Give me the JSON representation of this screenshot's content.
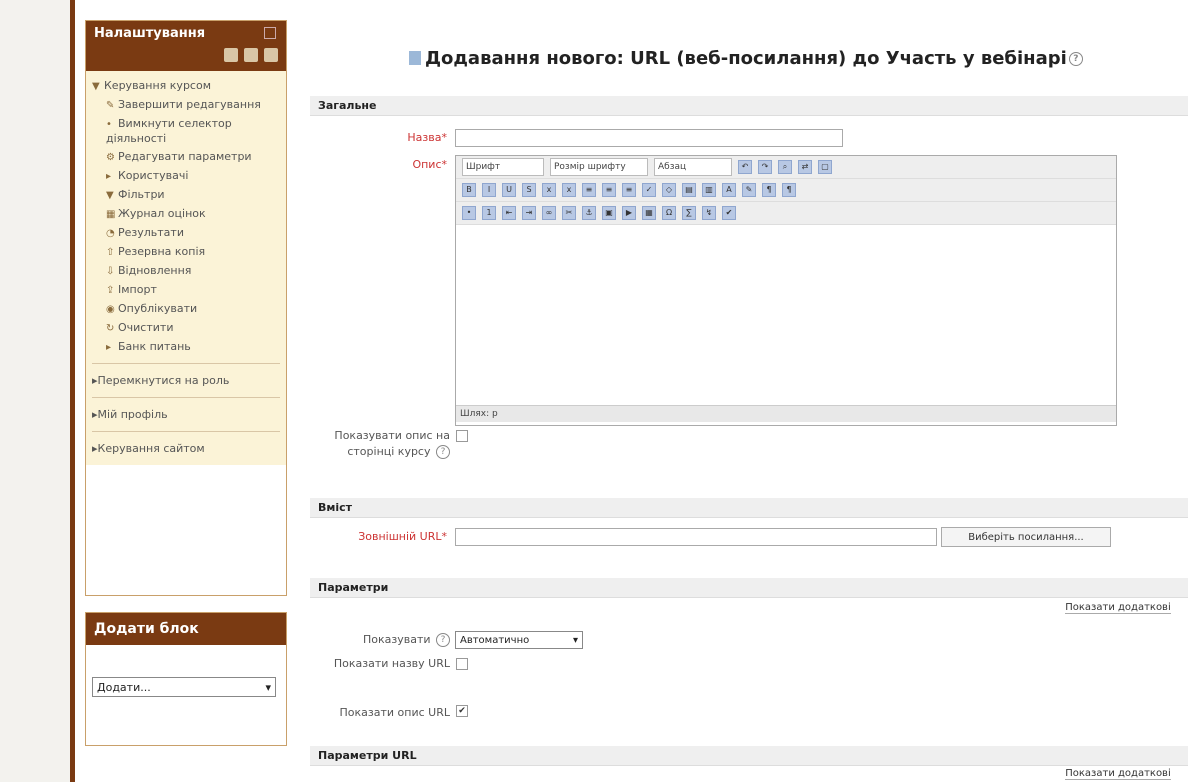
{
  "sidebar": {
    "settings_title": "Налаштування",
    "course_admin": "Керування курсом",
    "items": [
      {
        "icon": "pencil-icon",
        "label": "Завершити редагування"
      },
      {
        "icon": "bullet-icon",
        "label": "Вимкнути селектор діяльності"
      },
      {
        "icon": "gear-icon",
        "label": "Редагувати параметри"
      },
      {
        "icon": "triangle-right-icon",
        "label": "Користувачі"
      },
      {
        "icon": "funnel-icon",
        "label": "Фільтри"
      },
      {
        "icon": "table-icon",
        "label": "Журнал оцінок"
      },
      {
        "icon": "chart-icon",
        "label": "Результати"
      },
      {
        "icon": "upload-icon",
        "label": "Резервна копія"
      },
      {
        "icon": "download-icon",
        "label": "Відновлення"
      },
      {
        "icon": "import-icon",
        "label": "Імпорт"
      },
      {
        "icon": "globe-icon",
        "label": "Опублікувати"
      },
      {
        "icon": "refresh-icon",
        "label": "Очистити"
      },
      {
        "icon": "triangle-right-icon",
        "label": "Банк питань"
      }
    ],
    "nav": [
      "Перемкнутися на роль",
      "Мій профіль",
      "Керування сайтом"
    ],
    "add_block_title": "Додати блок",
    "add_block_select": "Додати..."
  },
  "main": {
    "title": "Додавання нового: URL (веб-посилання) до Участь у вебінарі",
    "sections": {
      "general": "Загальне",
      "content": "Вміст",
      "params": "Параметри",
      "url_params": "Параметри URL"
    },
    "fields": {
      "name": "Назва",
      "description": "Опис",
      "show_description": "Показувати опис на сторінці курсу",
      "external_url": "Зовнішній URL",
      "show": "Показувати",
      "show_url_name": "Показати назву URL",
      "show_url_desc": "Показати опис URL"
    },
    "editor": {
      "font": "Шрифт",
      "font_size": "Розмір шрифту",
      "paragraph": "Абзац",
      "path": "Шлях: p"
    },
    "choose_link": "Виберіть посилання...",
    "show_more": "Показати додаткові",
    "display_value": "Автоматично",
    "required_mark": "*"
  }
}
